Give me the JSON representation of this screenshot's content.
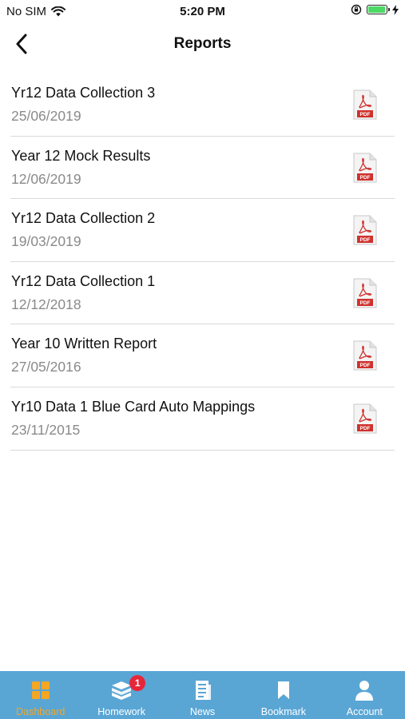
{
  "status_bar": {
    "carrier": "No SIM",
    "time": "5:20 PM"
  },
  "nav": {
    "title": "Reports"
  },
  "reports": [
    {
      "title": "Yr12 Data Collection 3",
      "date": "25/06/2019",
      "icon": "pdf-icon"
    },
    {
      "title": "Year 12 Mock Results",
      "date": "12/06/2019",
      "icon": "pdf-icon"
    },
    {
      "title": "Yr12 Data Collection 2",
      "date": "19/03/2019",
      "icon": "pdf-icon"
    },
    {
      "title": "Yr12 Data Collection 1",
      "date": "12/12/2018",
      "icon": "pdf-icon"
    },
    {
      "title": "Year 10 Written Report",
      "date": "27/05/2016",
      "icon": "pdf-icon"
    },
    {
      "title": "Yr10 Data 1 Blue Card Auto Mappings",
      "date": "23/11/2015",
      "icon": "pdf-icon"
    }
  ],
  "tabs": [
    {
      "label": "Dashboard",
      "icon": "dashboard-icon",
      "active": true
    },
    {
      "label": "Homework",
      "icon": "homework-icon",
      "badge": "1"
    },
    {
      "label": "News",
      "icon": "news-icon"
    },
    {
      "label": "Bookmark",
      "icon": "bookmark-icon"
    },
    {
      "label": "Account",
      "icon": "account-icon"
    }
  ],
  "colors": {
    "tab_bar": "#59a6d5",
    "active_tab": "#f5a623",
    "badge": "#e8263a",
    "pdf_red": "#d0312d",
    "battery": "#4cd964"
  }
}
